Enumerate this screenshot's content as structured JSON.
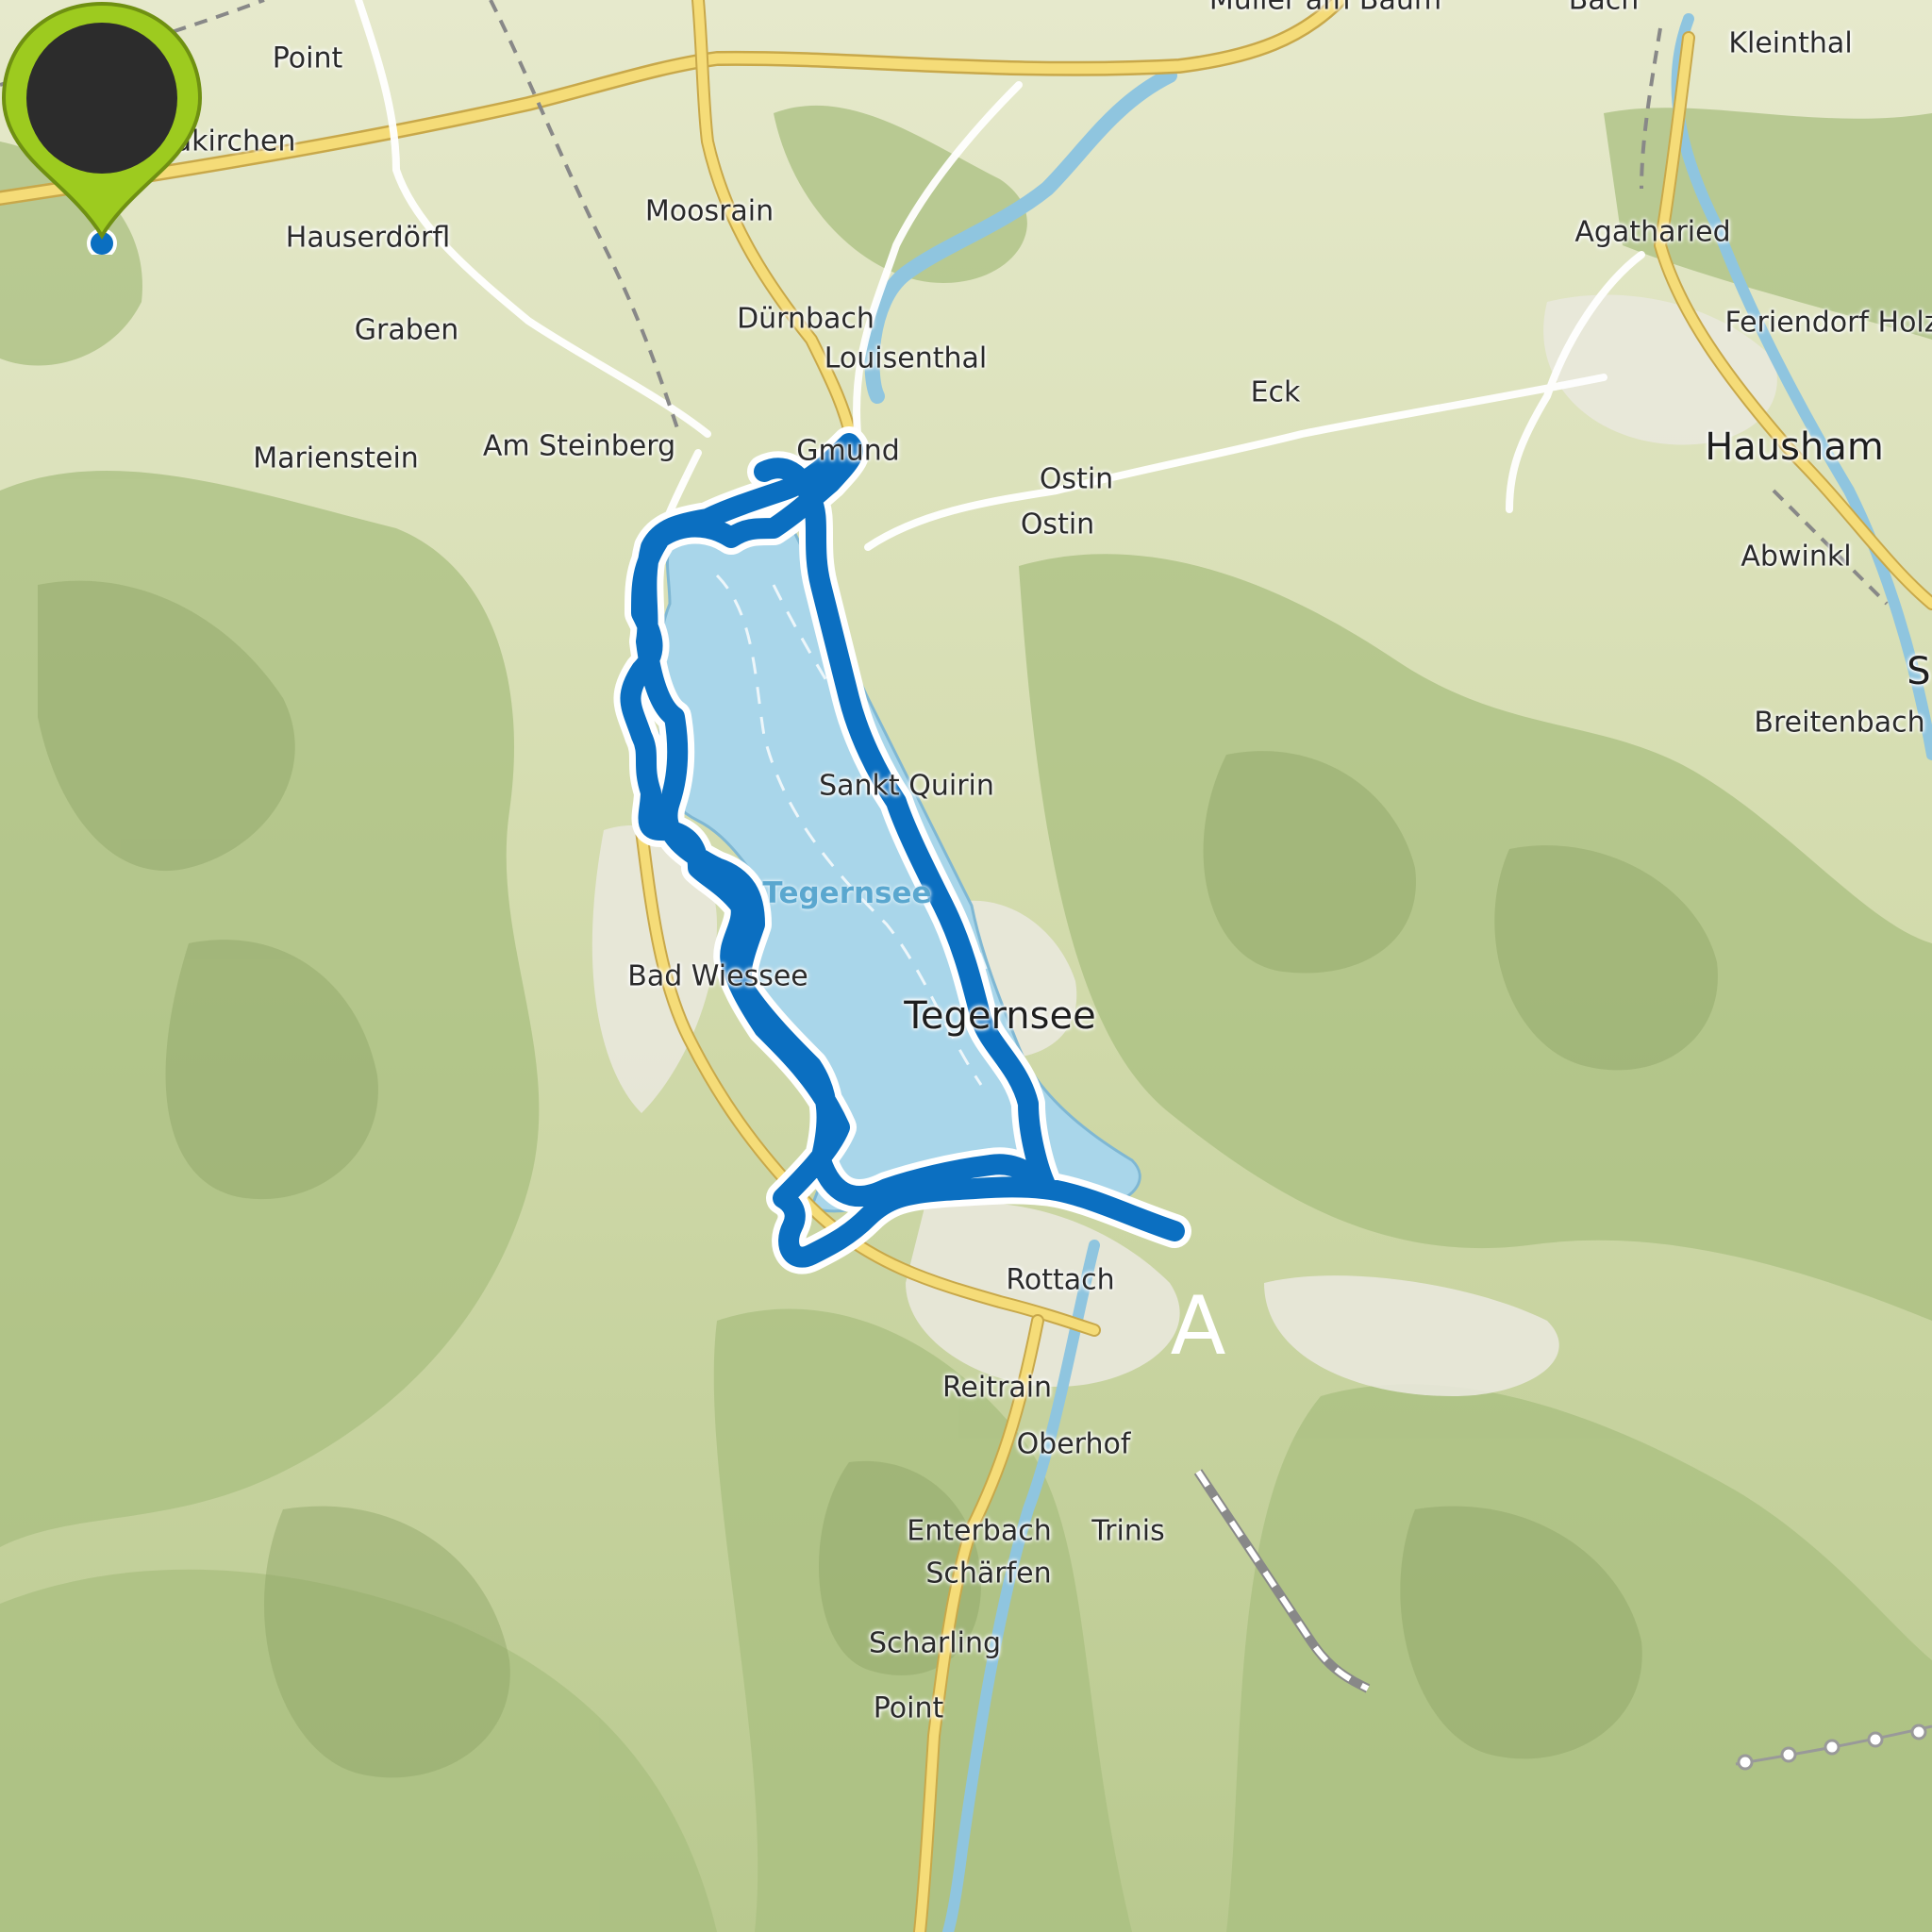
{
  "map": {
    "labels": [
      {
        "text": "Müller am Baum"
      },
      {
        "text": "Bach"
      },
      {
        "text": "Kleinthal"
      },
      {
        "text": "Point"
      },
      {
        "text": "Waakirchen"
      },
      {
        "text": "Moosrain"
      },
      {
        "text": "Hauserdörfl"
      },
      {
        "text": "Agatharied"
      },
      {
        "text": "Dürnbach"
      },
      {
        "text": "Louisenthal"
      },
      {
        "text": "Graben"
      },
      {
        "text": "Feriendorf Holz"
      },
      {
        "text": "Eck"
      },
      {
        "text": "Marienstein"
      },
      {
        "text": "Am Steinberg"
      },
      {
        "text": "Gmund"
      },
      {
        "text": "Hausham"
      },
      {
        "text": "Ostin"
      },
      {
        "text": "Ostin"
      },
      {
        "text": "Abwinkl"
      },
      {
        "text": "S"
      },
      {
        "text": "Breitenbach"
      },
      {
        "text": "Sankt Quirin"
      },
      {
        "text": "Tegernsee"
      },
      {
        "text": "Bad Wiessee"
      },
      {
        "text": "Tegernsee"
      },
      {
        "text": "Rottach"
      },
      {
        "text": "Reitrain"
      },
      {
        "text": "Oberhof"
      },
      {
        "text": "Enterbach"
      },
      {
        "text": "Trinis"
      },
      {
        "text": "Schärfen"
      },
      {
        "text": "Scharling"
      },
      {
        "text": "Point"
      }
    ],
    "lake_name": "Tegernsee",
    "colors": {
      "terrain": "#dfe5c2",
      "forest": "#a8c27e",
      "water": "#a9d6ea",
      "route": "#0b6fc1",
      "road": "#f2d872",
      "marker": "#9dcb1f"
    },
    "start_marker": {
      "letter": "A",
      "icon": "map-pin-icon"
    }
  }
}
